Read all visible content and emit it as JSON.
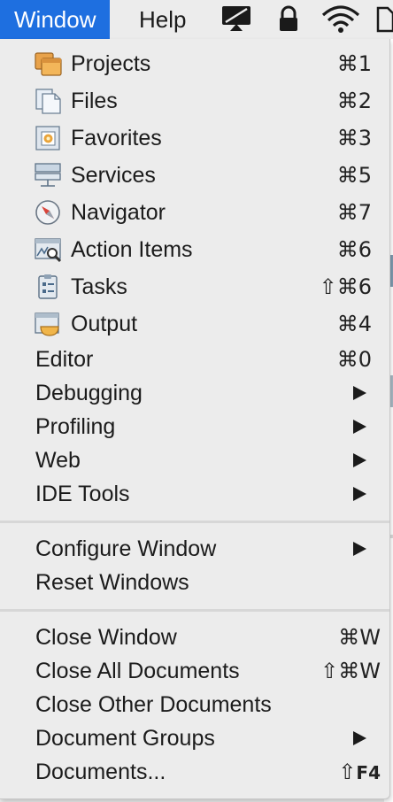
{
  "menubar": {
    "window_label": "Window",
    "help_label": "Help",
    "icons": [
      "display-mirroring-icon",
      "lock-icon",
      "wifi-icon",
      "document-icon"
    ]
  },
  "menu": {
    "items": [
      {
        "label": "Projects",
        "shortcut": "⌘1",
        "icon": "projects-icon"
      },
      {
        "label": "Files",
        "shortcut": "⌘2",
        "icon": "files-icon"
      },
      {
        "label": "Favorites",
        "shortcut": "⌘3",
        "icon": "favorites-icon"
      },
      {
        "label": "Services",
        "shortcut": "⌘5",
        "icon": "services-icon"
      },
      {
        "label": "Navigator",
        "shortcut": "⌘7",
        "icon": "navigator-icon"
      },
      {
        "label": "Action Items",
        "shortcut": "⌘6",
        "icon": "action-items-icon"
      },
      {
        "label": "Tasks",
        "shortcut": "⇧⌘6",
        "icon": "tasks-icon"
      },
      {
        "label": "Output",
        "shortcut": "⌘4",
        "icon": "output-icon"
      },
      {
        "label": "Editor",
        "shortcut": "⌘0"
      },
      {
        "label": "Debugging",
        "submenu": true
      },
      {
        "label": "Profiling",
        "submenu": true
      },
      {
        "label": "Web",
        "submenu": true
      },
      {
        "label": "IDE Tools",
        "submenu": true
      },
      {
        "label": "Configure Window",
        "submenu": true
      },
      {
        "label": "Reset Windows"
      },
      {
        "label": "Close Window",
        "shortcut": "⌘W"
      },
      {
        "label": "Close All Documents",
        "shortcut": "⇧⌘W"
      },
      {
        "label": "Close Other Documents"
      },
      {
        "label": "Document Groups",
        "submenu": true
      },
      {
        "label": "Documents...",
        "shortcut_modifier": "⇧",
        "shortcut_key": "F4"
      }
    ]
  },
  "colors": {
    "menu_highlight": "#1e6fe0",
    "menu_background": "#ececec",
    "text": "#1b1b1b"
  }
}
